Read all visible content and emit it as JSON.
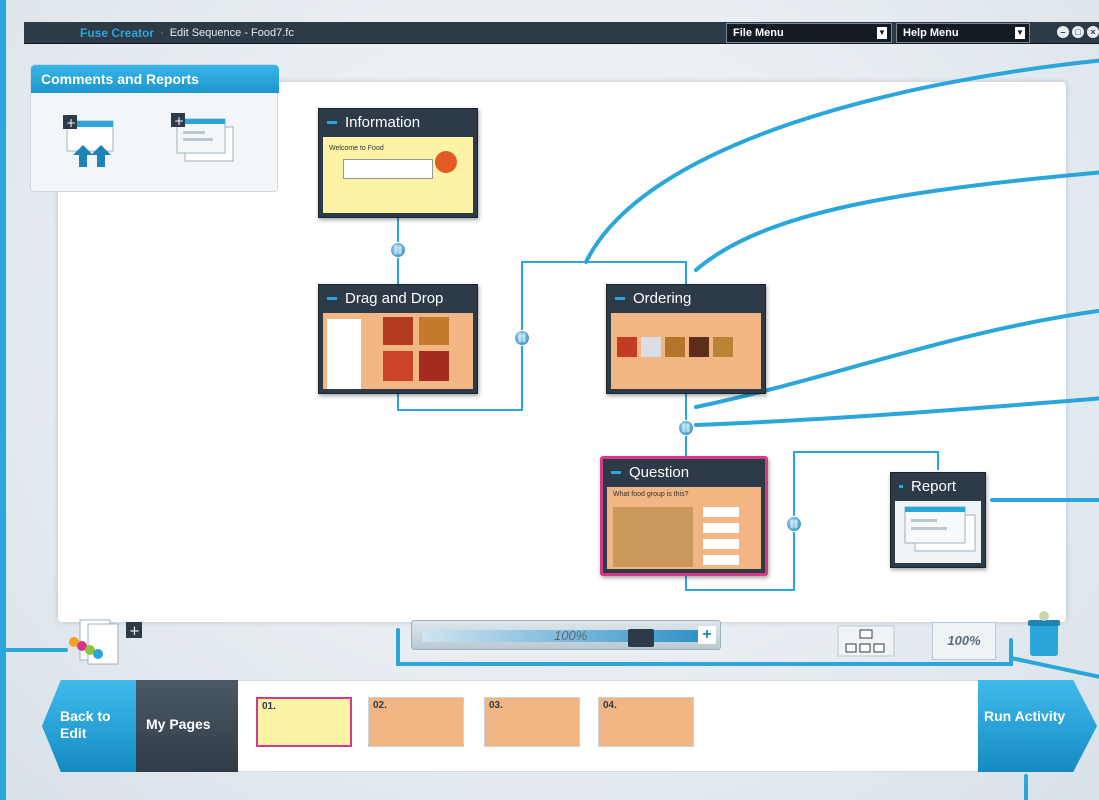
{
  "titlebar": {
    "app_name": "Fuse Creator",
    "separator": "·",
    "document": "Edit Sequence - Food7.fc",
    "file_menu": "File Menu",
    "help_menu": "Help Menu"
  },
  "comments_panel": {
    "title": "Comments and Reports"
  },
  "nodes": {
    "information": {
      "title": "Information",
      "content": "Welcome to Food"
    },
    "drag_and_drop": {
      "title": "Drag and Drop"
    },
    "ordering": {
      "title": "Ordering"
    },
    "question": {
      "title": "Question",
      "content": "What food group is this?"
    },
    "report": {
      "title": "Report"
    }
  },
  "zoom": {
    "label": "100%",
    "fit_label": "100%"
  },
  "pagebar": {
    "back_label": "Back to Edit",
    "my_pages_label": "My Pages",
    "run_label": "Run Activity",
    "pages": [
      "01.",
      "02.",
      "03.",
      "04."
    ]
  },
  "colors": {
    "accent": "#2aa6db",
    "titlebar": "#2d3a48",
    "selected": "#d6398a",
    "node_body": "#f1b684",
    "info_body": "#fcf3a6"
  }
}
